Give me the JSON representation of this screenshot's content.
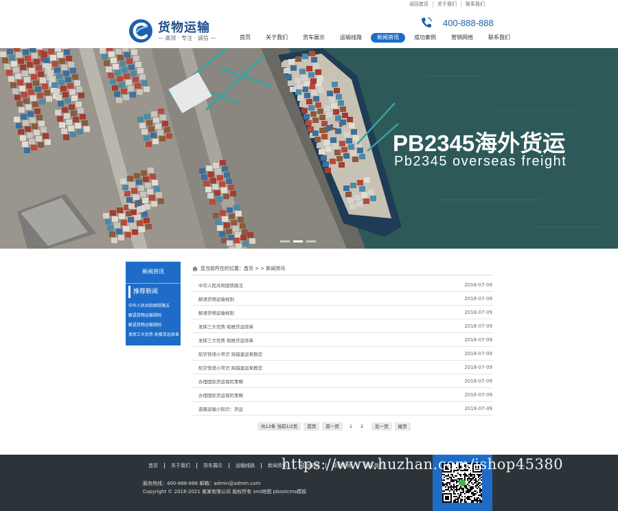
{
  "top_links": [
    "返回首页",
    "关于我们",
    "联系我们"
  ],
  "logo": {
    "title": "货物运输",
    "slogan": "— 高效 · 专注 · 诚信 —"
  },
  "phone": "400-888-888",
  "nav": [
    {
      "label": "首页",
      "active": false
    },
    {
      "label": "关于我们",
      "active": false
    },
    {
      "label": "货车展示",
      "active": false
    },
    {
      "label": "运输线路",
      "active": false
    },
    {
      "label": "新闻资讯",
      "active": true
    },
    {
      "label": "成功案例",
      "active": false
    },
    {
      "label": "营销网络",
      "active": false
    },
    {
      "label": "联系我们",
      "active": false
    }
  ],
  "banner": {
    "title": "PB2345海外货运",
    "subtitle": "Pb2345 overseas freight",
    "slides": 3,
    "active_slide": 2
  },
  "sidebar": {
    "heading": "新闻资讯",
    "subheading": "推荐新闻",
    "links": [
      "中华人民共和国铁路法",
      "解语货物运输规则",
      "解语货物运输规则",
      "发挥三大优势 助推货运改革"
    ]
  },
  "breadcrumb": {
    "prefix": "您当前所在的位置：",
    "path": "首页 > > 新闻资讯"
  },
  "news": [
    {
      "title": "中华人民共和国铁路法",
      "date": "2018-07-09"
    },
    {
      "title": "解语货物运输规则",
      "date": "2018-07-09"
    },
    {
      "title": "解语货物运输规则",
      "date": "2018-07-09"
    },
    {
      "title": "发挥三大优势 助推货运改革",
      "date": "2018-07-09"
    },
    {
      "title": "发挥三大优势 助推货运改革",
      "date": "2018-07-09"
    },
    {
      "title": "航空快递小常识 跨越速运来教您",
      "date": "2018-07-09"
    },
    {
      "title": "航空快递小常识 跨越速运来教您",
      "date": "2018-07-09"
    },
    {
      "title": "办理国际货运保险策略",
      "date": "2018-07-09"
    },
    {
      "title": "办理国际货运保险策略",
      "date": "2018-07-09"
    },
    {
      "title": "道路运输小知识：货运",
      "date": "2018-07-09"
    }
  ],
  "pager": {
    "summary": "共12条 当前1/2页",
    "first": "首页",
    "prev": "前一页",
    "pages": [
      "1",
      "2"
    ],
    "next": "后一页",
    "last": "尾页"
  },
  "footer": {
    "links": [
      "首页",
      "关于我们",
      "货车展示",
      "运输线路",
      "新闻资讯",
      "成功案例",
      "营销网络",
      "联系我们"
    ],
    "contact": "服务热线：400-888-888 邮箱：admin@admin.com",
    "copyright": "Copyright © 2018-2021 某某有限公司 版权所有 xml地图 pbootcms模板"
  },
  "watermark": "https://www.huzhan.com/ishop45380",
  "colors": {
    "primary": "#1e6cc8",
    "footer_bg": "#2d3439",
    "sea": "#2f5a59"
  }
}
